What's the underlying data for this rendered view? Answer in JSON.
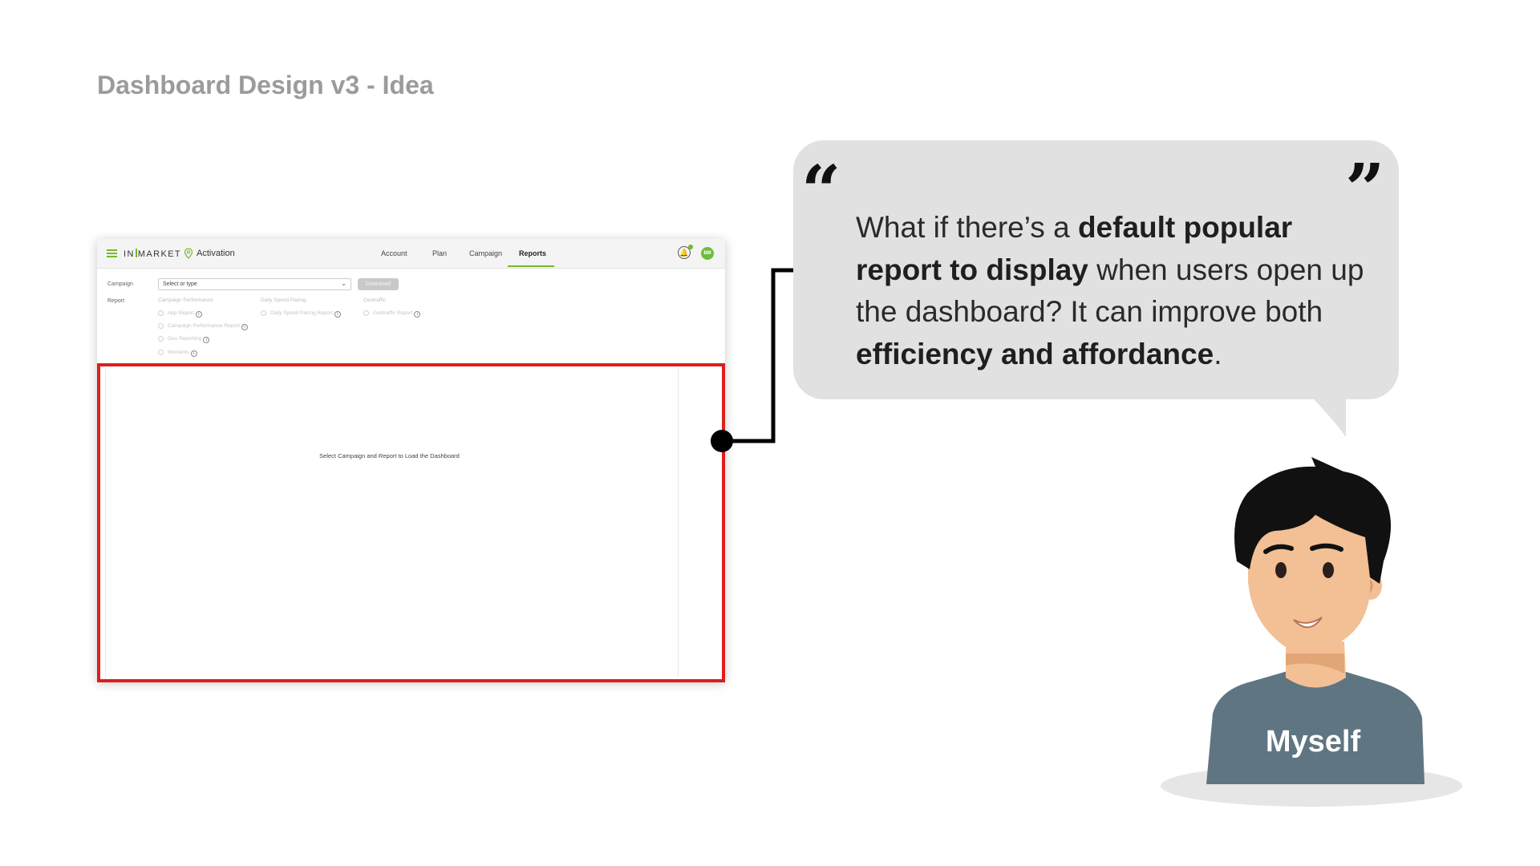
{
  "slide": {
    "title": "Dashboard Design v3 - Idea"
  },
  "mock_dashboard": {
    "logo_text_left": "IN",
    "logo_text_right": "MARKET",
    "app_name": "Activation",
    "nav": {
      "account": "Account",
      "plan": "Plan",
      "campaign": "Campaign",
      "reports": "Reports",
      "active_tab": "Reports"
    },
    "user_initials": "BM",
    "campaign_label": "Campaign",
    "campaign_placeholder": "Select or type",
    "download_label": "Download",
    "report_label": "Report",
    "report_groups": [
      {
        "heading": "Campaign Performance",
        "options": [
          "App Report",
          "Campaign Performance Report",
          "Geo Reporting",
          "Moments"
        ]
      },
      {
        "heading": "Daily Spend Pacing",
        "options": [
          "Daily Spend Pacing Report"
        ]
      },
      {
        "heading": "Geotraffic",
        "options": [
          "Geotraffic Report"
        ]
      }
    ],
    "info_glyph": "i",
    "empty_state": "Select Campaign and Report to Load the Dashboard"
  },
  "speech_bubble": {
    "open_quote": "“",
    "close_quote": "”",
    "part1": "What if there’s a ",
    "bold1": "default popular report to display",
    "part2": " when users open up the dashboard? It can improve both ",
    "bold2": "efficiency and affordance",
    "part3": "."
  },
  "persona": {
    "label": "Myself"
  },
  "colors": {
    "brand_green": "#76b82a",
    "highlight_red": "#dd1e1e",
    "bubble_gray": "#e1e1e1",
    "shirt": "#5f7582",
    "skin": "#f3bf94",
    "hair": "#111111"
  }
}
